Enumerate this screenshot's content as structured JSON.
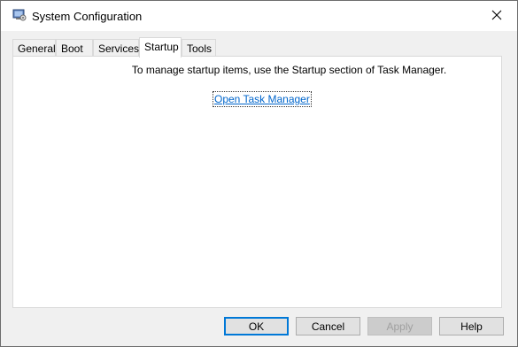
{
  "window": {
    "title": "System Configuration"
  },
  "tabs": [
    {
      "label": "General",
      "active": false
    },
    {
      "label": "Boot",
      "active": false
    },
    {
      "label": "Services",
      "active": false
    },
    {
      "label": "Startup",
      "active": true
    },
    {
      "label": "Tools",
      "active": false
    }
  ],
  "startup": {
    "message": "To manage startup items, use the Startup section of Task Manager.",
    "link_text": "Open Task Manager"
  },
  "buttons": {
    "ok": "OK",
    "cancel": "Cancel",
    "apply": "Apply",
    "help": "Help"
  },
  "colors": {
    "link": "#0066cc",
    "default_button_border": "#0078d7"
  },
  "icons": {
    "app": "system-configuration-icon",
    "close": "close-icon"
  }
}
